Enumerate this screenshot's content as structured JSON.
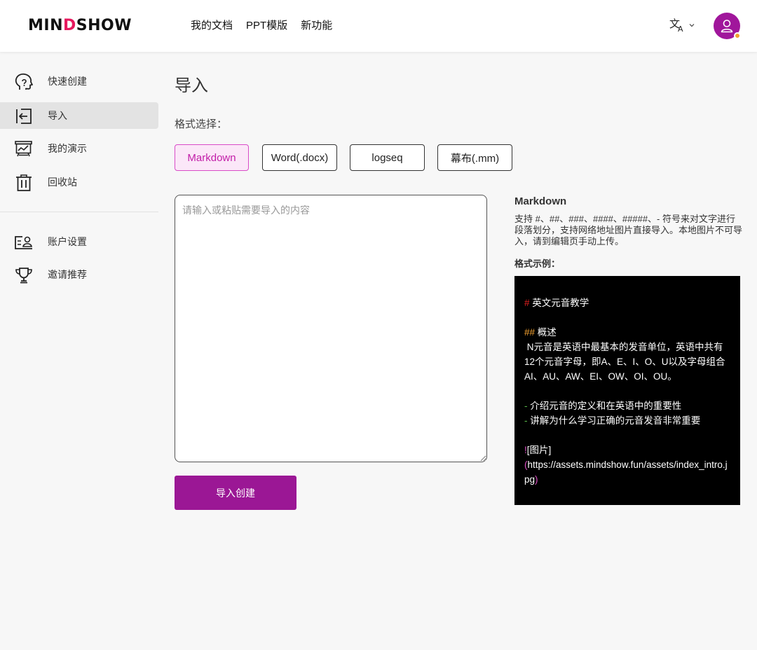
{
  "header": {
    "logo_pre": "MIN",
    "logo_d": "D",
    "logo_post": "SHOW",
    "nav": [
      "我的文档",
      "PPT模版",
      "新功能"
    ],
    "lang_icon": "translate-icon",
    "avatar_icon": "user-icon"
  },
  "sidebar": {
    "items": [
      {
        "label": "快速创建",
        "icon": "brain-head-icon"
      },
      {
        "label": "导入",
        "icon": "import-icon"
      },
      {
        "label": "我的演示",
        "icon": "presentation-icon"
      },
      {
        "label": "回收站",
        "icon": "trash-icon"
      },
      {
        "label": "账户设置",
        "icon": "account-card-icon"
      },
      {
        "label": "邀请推荐",
        "icon": "trophy-icon"
      }
    ]
  },
  "main": {
    "title": "导入",
    "format_label": "格式选择：",
    "formats": [
      "Markdown",
      "Word(.docx)",
      "logseq",
      "幕布(.mm)"
    ],
    "selected_format": "Markdown",
    "editor_placeholder": "请输入或粘贴需要导入的内容",
    "submit_label": "导入创建"
  },
  "info": {
    "title": "Markdown",
    "description": "支持 #、##、###、####、#####、- 符号来对文字进行段落划分，支持网络地址图片直接导入。本地图片不可导入，请到编辑页手动上传。",
    "example_label": "格式示例：",
    "example": {
      "h1_mark": "#",
      "h1_text": " 英文元音教学",
      "h2_mark": "##",
      "h2_text": " 概述",
      "para_lines": [
        " N元音是英语中最基本的发音单位，英语中共有",
        "12个元音字母，即A、E、I、O、U以及字母组合",
        "AI、AU、AW、EI、OW、OI、OU。"
      ],
      "bullet_mark": "-",
      "bullets": [
        " 介绍元音的定义和在英语中的重要性",
        " 讲解为什么学习正确的元音发音非常重要"
      ],
      "img_mark": "!",
      "img_alt": "[图片]",
      "img_open": "(",
      "img_url_1": "https://assets.mindshow.fun/assets/index_intro.j",
      "img_url_2": "pg",
      "img_close": ")"
    },
    "colors": {
      "h1_mark": "#e02020",
      "h2_mark": "#f0a030",
      "bullet_mark": "#58b848",
      "img_mark": "#e050c8"
    }
  }
}
